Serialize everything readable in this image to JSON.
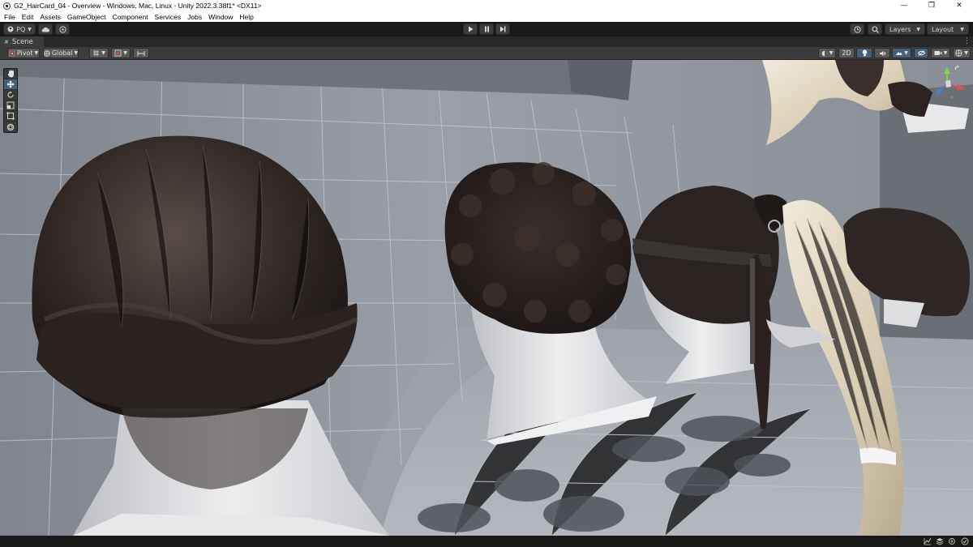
{
  "window": {
    "title": "G2_HairCard_04 - Overview - Windows, Mac, Linux - Unity 2022.3.38f1* <DX11>",
    "controls": [
      "—",
      "❐",
      "✕"
    ]
  },
  "menu": [
    "File",
    "Edit",
    "Assets",
    "GameObject",
    "Component",
    "Services",
    "Jobs",
    "Window",
    "Help"
  ],
  "toolbar": {
    "account_label": "PQ",
    "layers_label": "Layers",
    "layout_label": "Layout"
  },
  "scene_tab": {
    "label": "Scene",
    "hash_icon": "#"
  },
  "scene_toolbar": {
    "pivot_label": "Pivot",
    "global_label": "Global",
    "mode_2d_label": "2D"
  },
  "tools": [
    "hand-tool",
    "move-tool",
    "rotate-tool",
    "scale-tool",
    "rect-tool",
    "transform-tool"
  ],
  "colors": {
    "editor_bg": "#191919",
    "toolbar_bg": "#3c3c3c",
    "active_blue": "#46607c",
    "scene_wall": "#8f949c",
    "scene_floor": "#a5a9b0",
    "dark_hair": "#2b2321",
    "blonde_hair": "#e6ddc9",
    "skin": "#dcdcdf"
  }
}
